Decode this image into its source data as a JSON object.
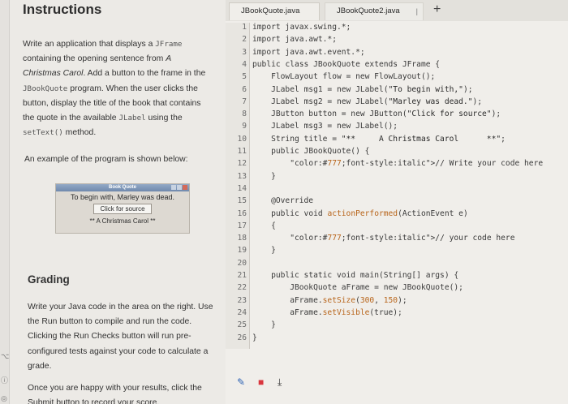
{
  "instructions": {
    "title": "Instructions",
    "para1": [
      [
        "Write an application that displays a ",
        "JFrame"
      ],
      [
        "containing the opening sentence from ",
        "A"
      ],
      [
        "Christmas Carol",
        ". Add a button to the frame in the"
      ],
      [
        "JBookQuote",
        " program. When the user clicks the"
      ],
      [
        "button, display the title of the book that contains",
        ""
      ],
      [
        "the quote in the available ",
        "JLabel",
        " using the"
      ],
      [
        "setText()",
        " method."
      ]
    ],
    "example_intro": "An example of the program is shown below:",
    "example_window": {
      "title": "Book Quote",
      "label1": "To begin with, Marley was dead.",
      "button": "Click for source",
      "label3": "** A Christmas Carol **"
    },
    "grading_title": "Grading",
    "grading_lines": [
      "Write your Java code in the area on the right. Use",
      "the Run button to compile and run the code.",
      "Clicking the Run Checks button will run pre-",
      "configured tests against your code to calculate a",
      "grade."
    ],
    "submit_lines": [
      "Once you are happy with your results, click the",
      "Submit button to record your score."
    ]
  },
  "editor": {
    "tabs": [
      "JBookQuote.java",
      "JBookQuote2.java"
    ],
    "add_tab": "+",
    "lines": [
      {
        "n": "1",
        "t": "import javax.swing.*;"
      },
      {
        "n": "2",
        "t": "import java.awt.*;"
      },
      {
        "n": "3",
        "t": "import java.awt.event.*;"
      },
      {
        "n": "4",
        "t": "public class JBookQuote extends JFrame {"
      },
      {
        "n": "5",
        "t": "    FlowLayout flow = new FlowLayout();"
      },
      {
        "n": "6",
        "t": "    JLabel msg1 = new JLabel(\"To begin with,\");"
      },
      {
        "n": "7",
        "t": "    JLabel msg2 = new JLabel(\"Marley was dead.\");"
      },
      {
        "n": "8",
        "t": "    JButton button = new JButton(\"Click for source\");"
      },
      {
        "n": "9",
        "t": "    JLabel msg3 = new JLabel();"
      },
      {
        "n": "10",
        "t": "    String title = \"**     A Christmas Carol      **\";"
      },
      {
        "n": "11",
        "t": "    public JBookQuote() {"
      },
      {
        "n": "12",
        "t": "        // Write your code here"
      },
      {
        "n": "13",
        "t": "    }"
      },
      {
        "n": "14",
        "t": ""
      },
      {
        "n": "15",
        "t": "    @Override"
      },
      {
        "n": "16",
        "t": "    public void actionPerformed(ActionEvent e)"
      },
      {
        "n": "17",
        "t": "    {"
      },
      {
        "n": "18",
        "t": "        // your code here"
      },
      {
        "n": "19",
        "t": "    }"
      },
      {
        "n": "20",
        "t": ""
      },
      {
        "n": "21",
        "t": "    public static void main(String[] args) {"
      },
      {
        "n": "22",
        "t": "        JBookQuote aFrame = new JBookQuote();"
      },
      {
        "n": "23",
        "t": "        aFrame.setSize(300, 150);"
      },
      {
        "n": "24",
        "t": "        aFrame.setVisible(true);"
      },
      {
        "n": "25",
        "t": "    }"
      },
      {
        "n": "26",
        "t": "}"
      }
    ]
  },
  "colors": {
    "accent": "#1f78c8",
    "pencil": "#2e63b5",
    "trash": "#d9363e",
    "download": "#333333"
  }
}
